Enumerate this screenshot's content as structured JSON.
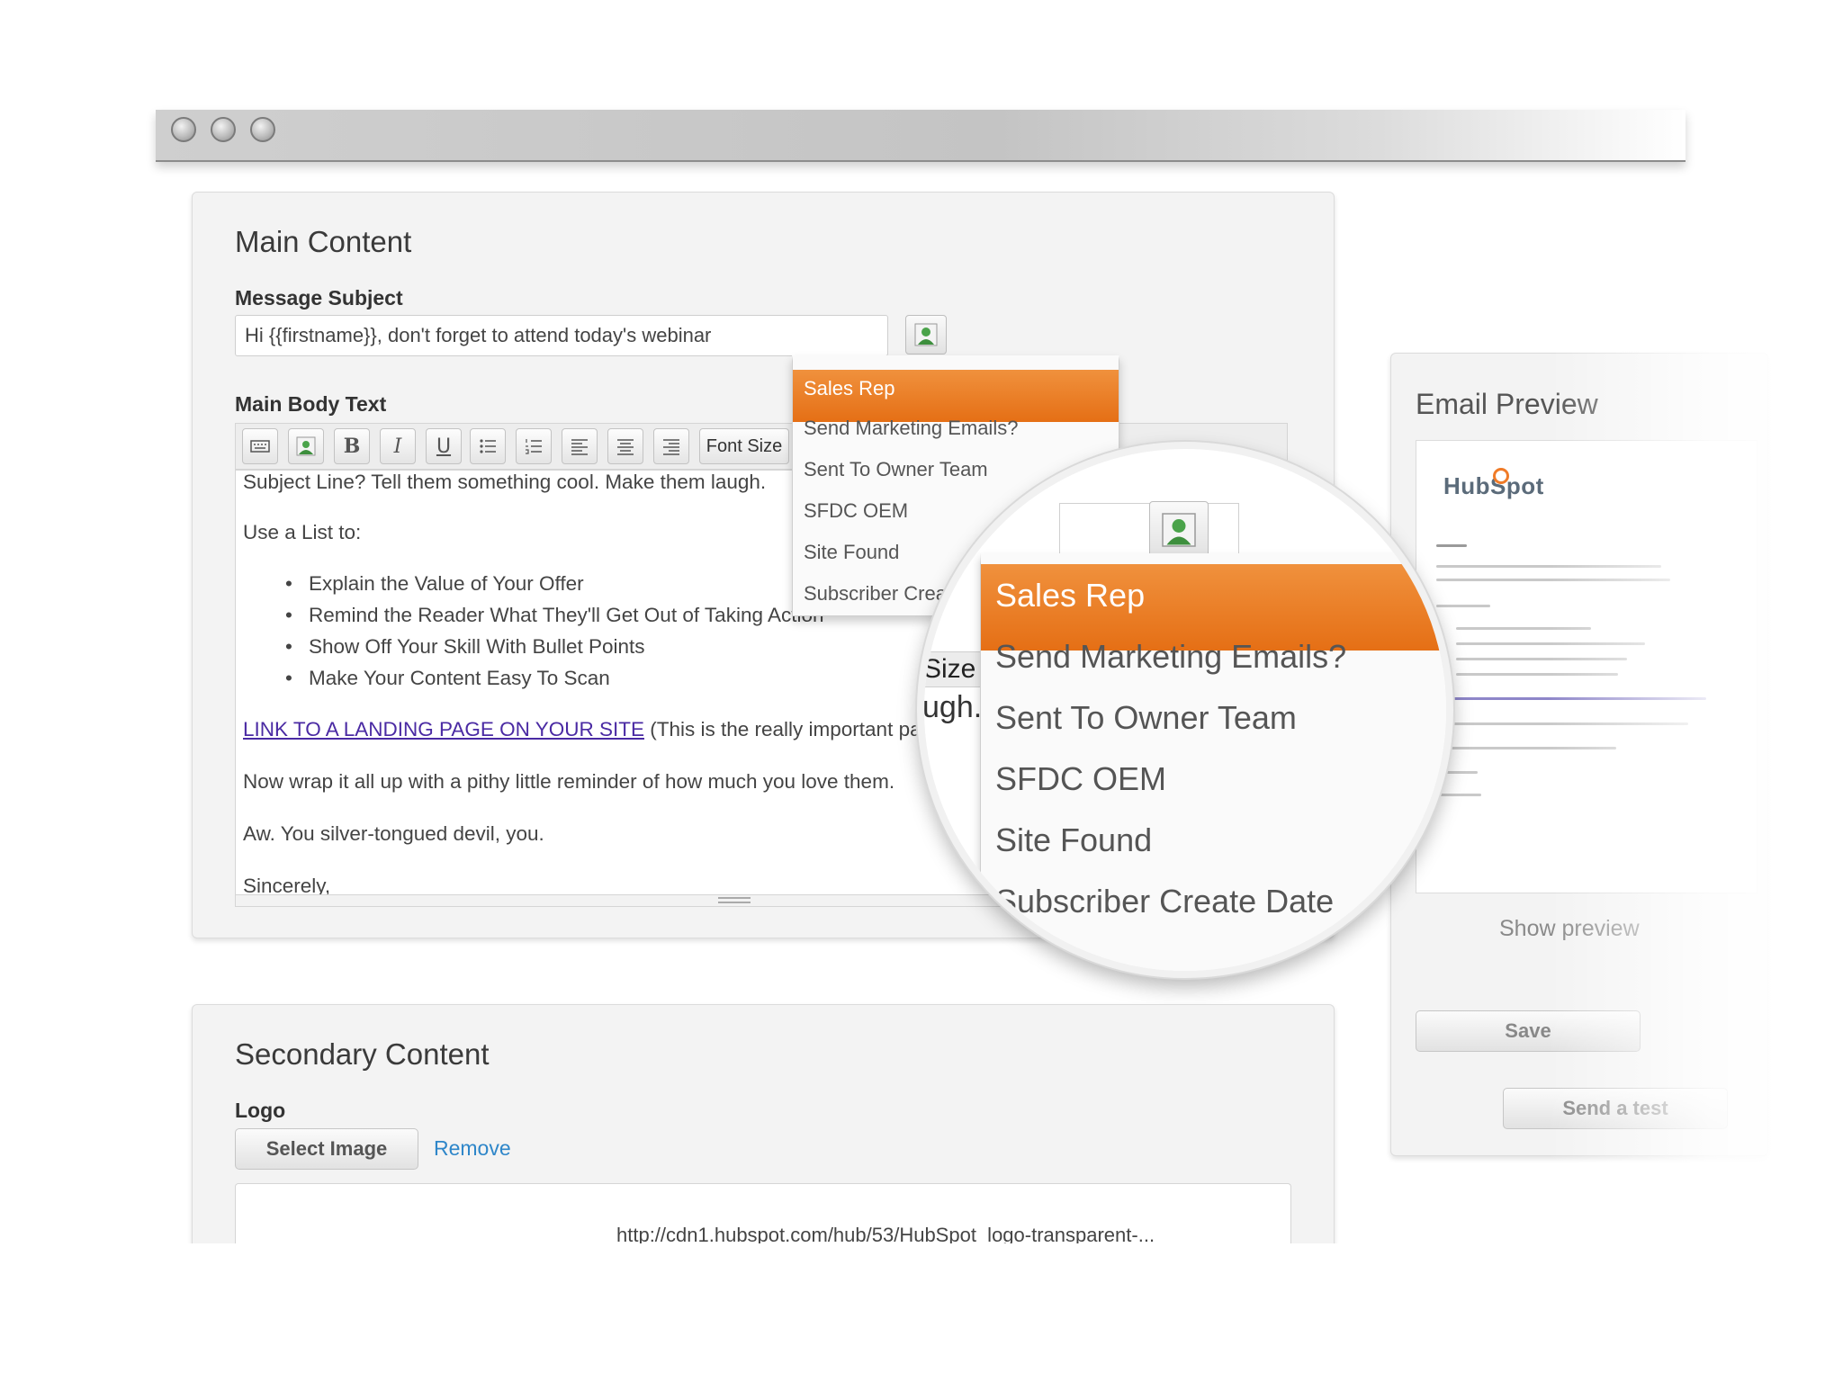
{
  "window": {
    "controls": [
      "close",
      "minimize",
      "zoom"
    ]
  },
  "main_content": {
    "title": "Main Content",
    "subject_label": "Message Subject",
    "subject_value": "Hi {{firstname}}, don't forget to attend today's webinar",
    "body_label": "Main Body Text",
    "toolbar": {
      "bold": "B",
      "italic": "I",
      "underline": "U",
      "font_size_label": "Font Size"
    },
    "body": {
      "line1": "Subject Line? Tell them something cool. Make them laugh.",
      "list_intro": "Use a List to:",
      "bullets": [
        "Explain the Value of Your Offer",
        "Remind the Reader What They'll Get Out of Taking Action",
        "Show Off Your Skill With Bullet Points",
        "Make Your Content Easy To Scan"
      ],
      "link_text": "LINK TO A LANDING PAGE ON YOUR SITE",
      "link_note": "(This is the really important part.)",
      "wrap": "Now wrap it all up with a pithy little reminder of how much you love them.",
      "aw": "Aw. You silver-tongued devil, you.",
      "closing": "Sincerely,"
    }
  },
  "personalization_menu": {
    "items": [
      "Sales Rep",
      "Send Marketing Emails?",
      "Sent To Owner Team",
      "SFDC OEM",
      "Site Found",
      "Subscriber Create Date"
    ],
    "selected": "Sales Rep",
    "colors": {
      "selected_bg": "#e9781f",
      "selected_text": "#ffffff"
    }
  },
  "magnifier": {
    "fragment_size": "Size",
    "fragment_laugh": "ugh."
  },
  "email_preview": {
    "title": "Email Preview",
    "brand": "HubSpot",
    "show_preview": "Show preview",
    "save": "Save",
    "send": "Send a test"
  },
  "secondary_content": {
    "title": "Secondary Content",
    "logo_label": "Logo",
    "select_image": "Select Image",
    "remove": "Remove",
    "logo_url": "http://cdn1.hubspot.com/hub/53/HubSpot_logo-transparent-..."
  }
}
